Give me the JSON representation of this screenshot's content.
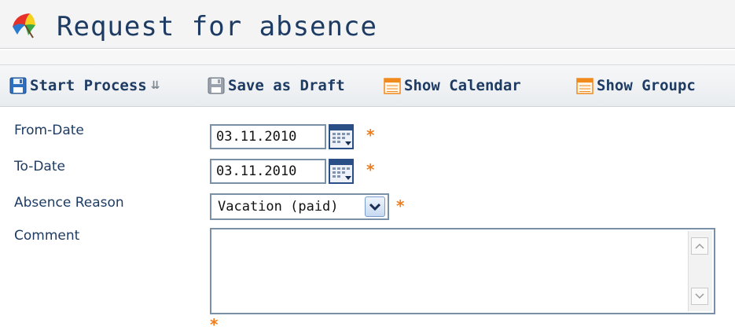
{
  "header": {
    "title": "Request for absence",
    "icon": "umbrella-icon"
  },
  "toolbar": {
    "start_process": "Start Process",
    "save_as_draft": "Save as Draft",
    "show_calendar": "Show Calendar",
    "show_groupcalendar": "Show Groupc"
  },
  "form": {
    "from_date_label": "From-Date",
    "from_date_value": "03.11.2010",
    "to_date_label": "To-Date",
    "to_date_value": "03.11.2010",
    "absence_reason_label": "Absence Reason",
    "absence_reason_value": "Vacation (paid)",
    "comment_label": "Comment",
    "comment_value": "",
    "required_marker": "*"
  },
  "colors": {
    "title_text": "#1d3b63",
    "required": "#f07c1a",
    "input_border": "#7a8fa8"
  }
}
